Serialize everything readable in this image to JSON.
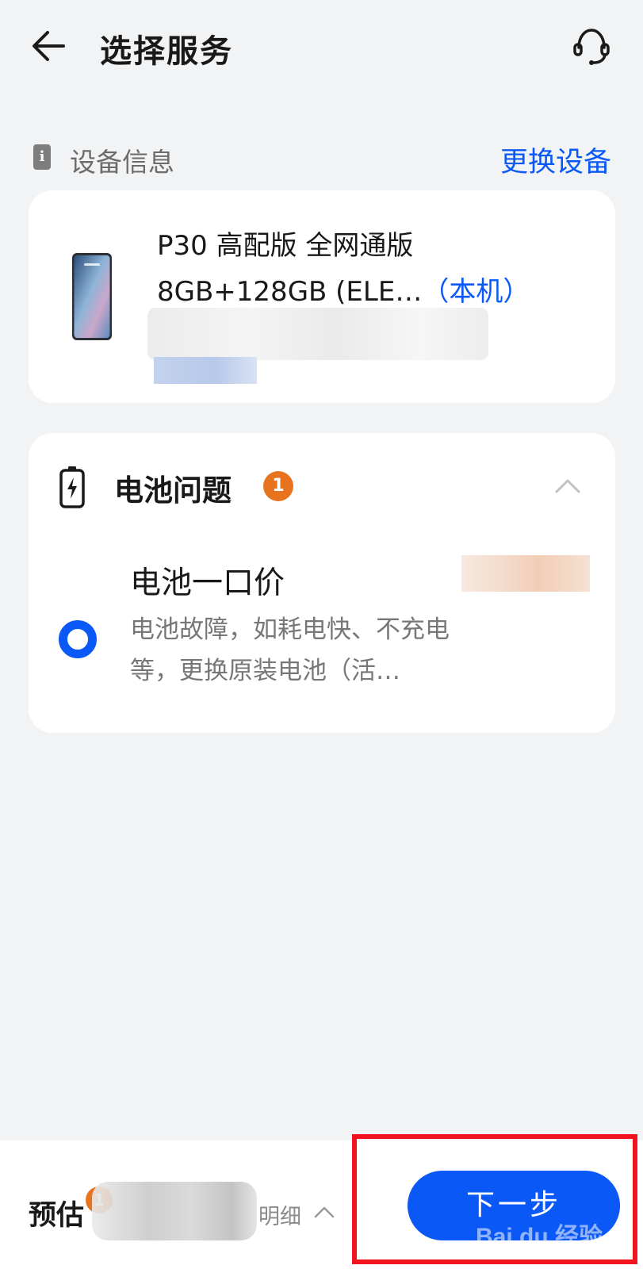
{
  "header": {
    "title": "选择服务",
    "back_icon": "arrow-left-icon",
    "service_icon": "customer-service-icon"
  },
  "device_section": {
    "label": "设备信息",
    "action": "更换设备",
    "device": {
      "model_line": "P30 高配版 全网通版",
      "spec_line": "8GB+128GB (ELE…",
      "this_phone_tag": "（本机）"
    }
  },
  "battery_section": {
    "title": "电池问题",
    "badge_count": "1",
    "service": {
      "name": "电池一口价",
      "description": "电池故障，如耗电快、不充电等，更换原装电池（活…",
      "selected": true
    }
  },
  "bottom_bar": {
    "estimate_label": "预估",
    "badge_count": "1",
    "details_label": "明细",
    "next_button": "下一步"
  },
  "watermark": "Bai du 经验",
  "colors": {
    "accent": "#0a59f7",
    "badge": "#e8731e",
    "background": "#f1f3f5",
    "highlight": "#f0141e"
  }
}
